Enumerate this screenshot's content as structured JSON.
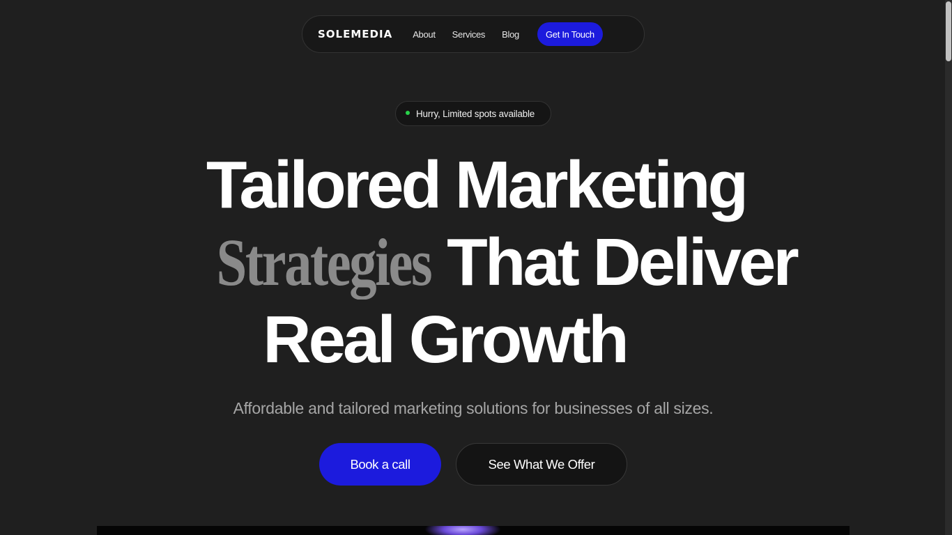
{
  "nav": {
    "logo": "SOLEMEDIA",
    "links": [
      "About",
      "Services",
      "Blog"
    ],
    "cta": "Get In Touch"
  },
  "badge": {
    "text": "Hurry, Limited spots available",
    "dot_color": "#28d34a"
  },
  "hero": {
    "line1": "Tailored Marketing",
    "line2_serif": "Strategies",
    "line2_sans": "That Deliver",
    "line3": "Real Growth",
    "subtitle": "Affordable and tailored marketing solutions for businesses of all sizes."
  },
  "actions": {
    "primary": "Book a call",
    "secondary": "See What We Offer"
  },
  "colors": {
    "background": "#1f1f1f",
    "accent": "#1c1bdd",
    "muted_text": "#a6a6a6",
    "serif_text": "#8a8a8a"
  }
}
